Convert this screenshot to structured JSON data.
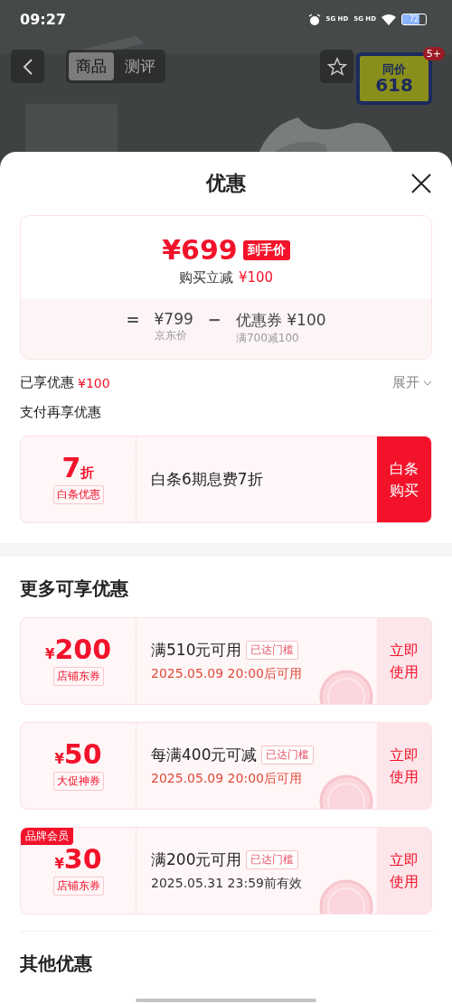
{
  "status_bar": {
    "time": "09:27",
    "network_1": "5G HD",
    "network_2": "5G HD",
    "battery": "72"
  },
  "product_header": {
    "tabs": [
      {
        "label": "商品",
        "selected": true
      },
      {
        "label": "测评",
        "selected": false
      }
    ],
    "promo_badge": {
      "line_1": "同价",
      "line_2": "618"
    },
    "notification_badge": "5+"
  },
  "sheet": {
    "title": "优惠",
    "price_card": {
      "price": "¥699",
      "price_tag": "到手价",
      "subtitle_label": "购买立减",
      "subtitle_amount": "¥100",
      "formula": [
        {
          "kind": "operator",
          "text": "="
        },
        {
          "kind": "term",
          "value": "¥799",
          "caption": "京东价"
        },
        {
          "kind": "operator",
          "text": "−"
        },
        {
          "kind": "term",
          "value": "优惠券 ¥100",
          "caption": "满700减100"
        }
      ]
    },
    "enjoyed": {
      "label": "已享优惠",
      "amount": "¥100",
      "toggle": "展开",
      "expanded": false
    },
    "payment_title": "支付再享优惠",
    "payment_offer": {
      "discount": "7",
      "unit": "折",
      "tag": "白条优惠",
      "description": "白条6期息费7折",
      "button": "白条购买"
    },
    "coupons_title": "更多可享优惠",
    "coupons": [
      {
        "currency": "¥",
        "amount": "200",
        "tag": "店铺东券",
        "title": "满510元可用",
        "threshold_tag": "已达门槛",
        "date": "2025.05.09 20:00后可用",
        "date_highlighted": true,
        "claimed": true,
        "button": "立即使用"
      },
      {
        "currency": "¥",
        "amount": "50",
        "tag": "大促神券",
        "title": "每满400元可减",
        "threshold_tag": "已达门槛",
        "date": "2025.05.09 20:00后可用",
        "date_highlighted": true,
        "claimed": true,
        "button": "立即使用"
      },
      {
        "currency": "¥",
        "amount": "30",
        "tag": "店铺东券",
        "member_tag": "品牌会员",
        "title": "满200元可用",
        "threshold_tag": "已达门槛",
        "date": "2025.05.31 23:59前有效",
        "date_highlighted": false,
        "claimed": true,
        "button": "立即使用"
      }
    ],
    "other_title": "其他优惠"
  }
}
